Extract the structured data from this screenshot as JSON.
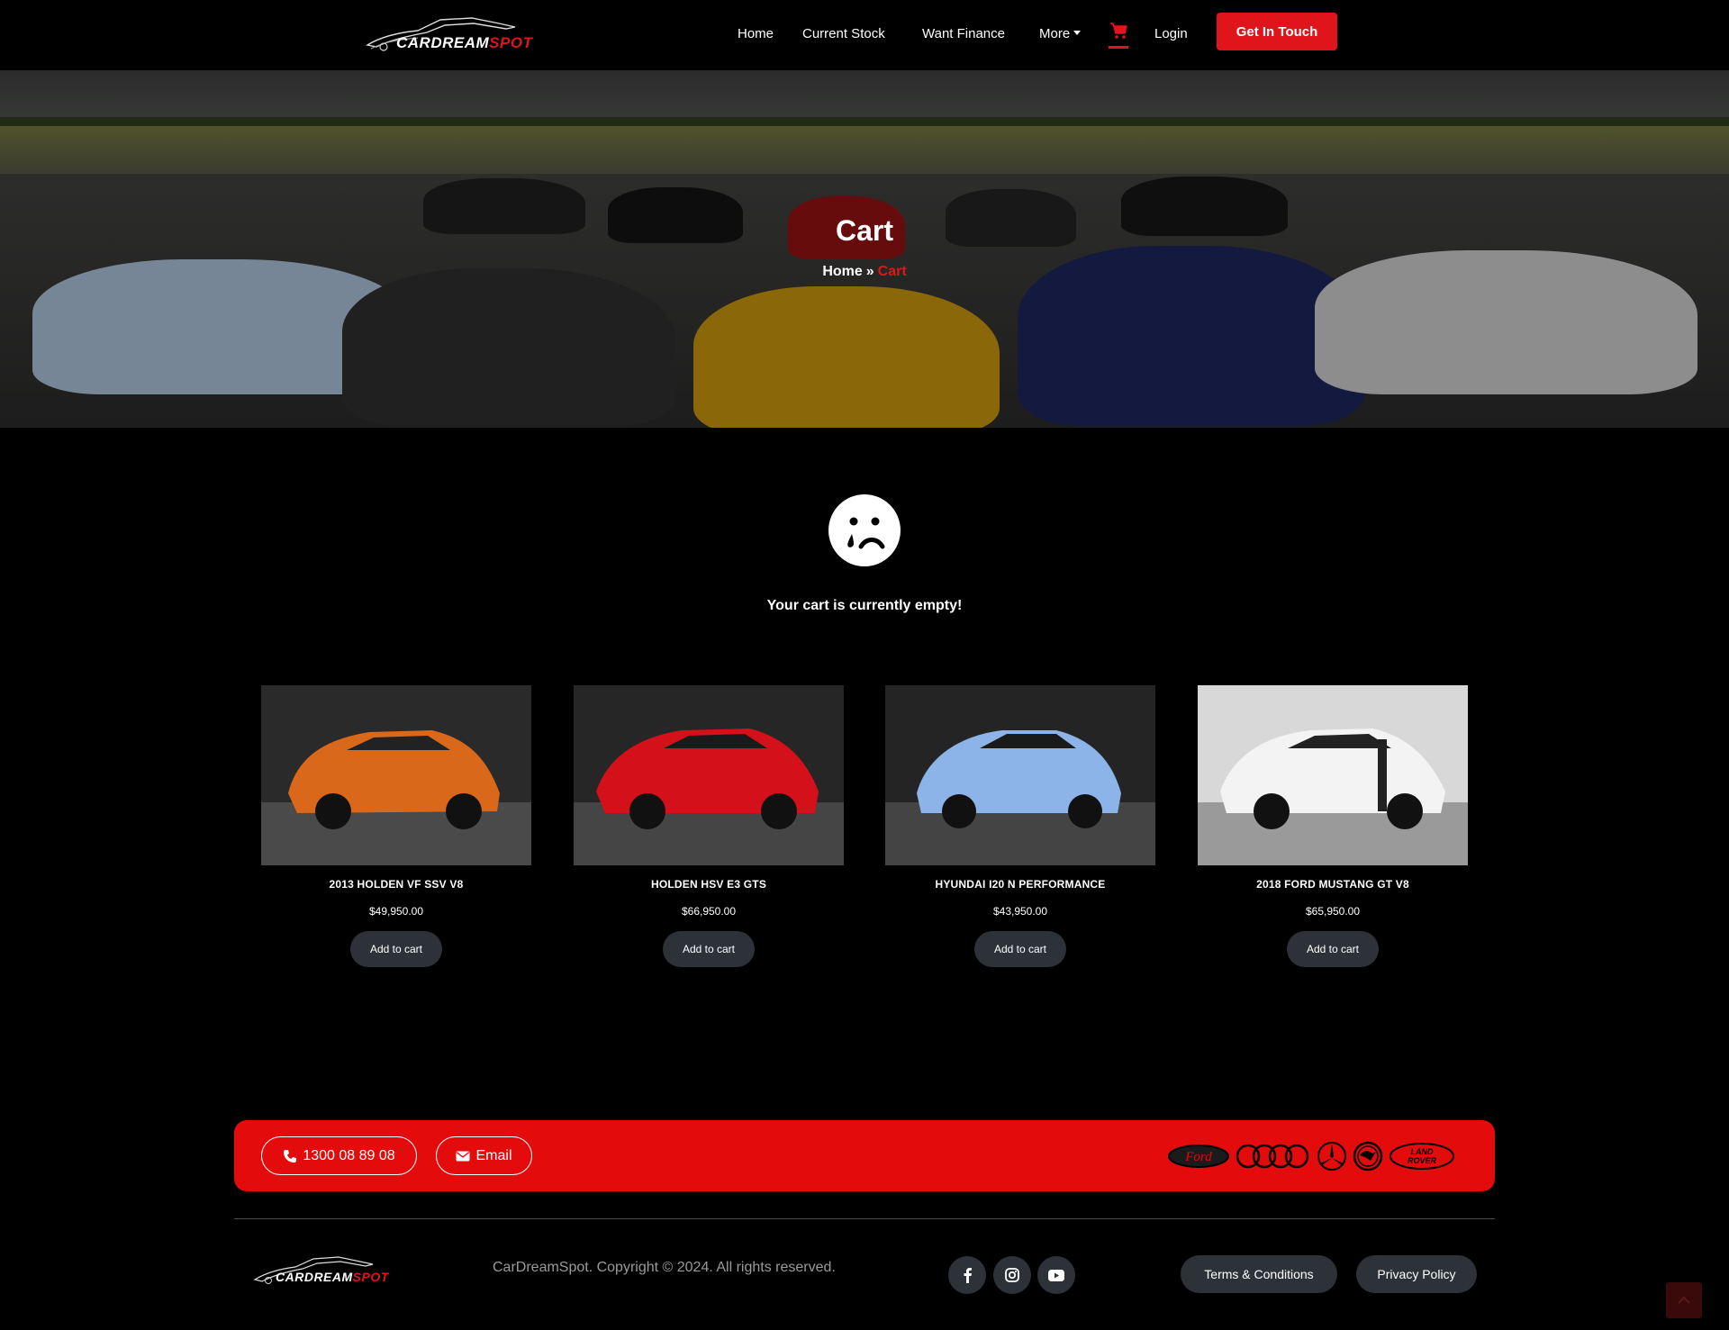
{
  "brand": {
    "name_white": "CARDREAM",
    "name_red": "SPOT"
  },
  "nav": {
    "home": "Home",
    "current_stock": "Current Stock",
    "want_finance": "Want Finance",
    "more": "More",
    "login": "Login",
    "cta": "Get In Touch"
  },
  "hero": {
    "title": "Cart",
    "breadcrumb_home": "Home",
    "breadcrumb_sep": "»",
    "breadcrumb_current": "Cart"
  },
  "cart": {
    "empty_message": "Your cart is currently empty!"
  },
  "products": [
    {
      "title": "2013 HOLDEN VF SSV V8",
      "price": "$49,950.00",
      "button": "Add to cart",
      "color": "#d9681b",
      "backdrop": "#2a2a2a"
    },
    {
      "title": "HOLDEN HSV E3 GTS",
      "price": "$66,950.00",
      "button": "Add to cart",
      "color": "#d4101a",
      "backdrop": "#262626"
    },
    {
      "title": "HYUNDAI I20 N PERFORMANCE",
      "price": "$43,950.00",
      "button": "Add to cart",
      "color": "#8db4e8",
      "backdrop": "#242424"
    },
    {
      "title": "2018 FORD MUSTANG GT V8",
      "price": "$65,950.00",
      "button": "Add to cart",
      "color": "#f3f3f3",
      "backdrop": "#d8d8d8"
    }
  ],
  "cta_bar": {
    "phone": "1300 08 89 08",
    "email": "Email",
    "brands": [
      "Ford",
      "Audi",
      "Mercedes-Benz",
      "Skoda",
      "Land Rover"
    ],
    "brand_ford_text": "Ford",
    "brand_landrover_line1": "LAND",
    "brand_landrover_line2": "ROVER"
  },
  "footer": {
    "copyright": "CarDreamSpot. Copyright © 2024. All rights reserved.",
    "social": [
      "facebook",
      "instagram",
      "youtube"
    ],
    "terms": "Terms & Conditions",
    "privacy": "Privacy Policy"
  },
  "colors": {
    "accent": "#e0151b",
    "cta_bar": "#e30b0b",
    "button_dark": "#2d3238",
    "background": "#000000"
  }
}
